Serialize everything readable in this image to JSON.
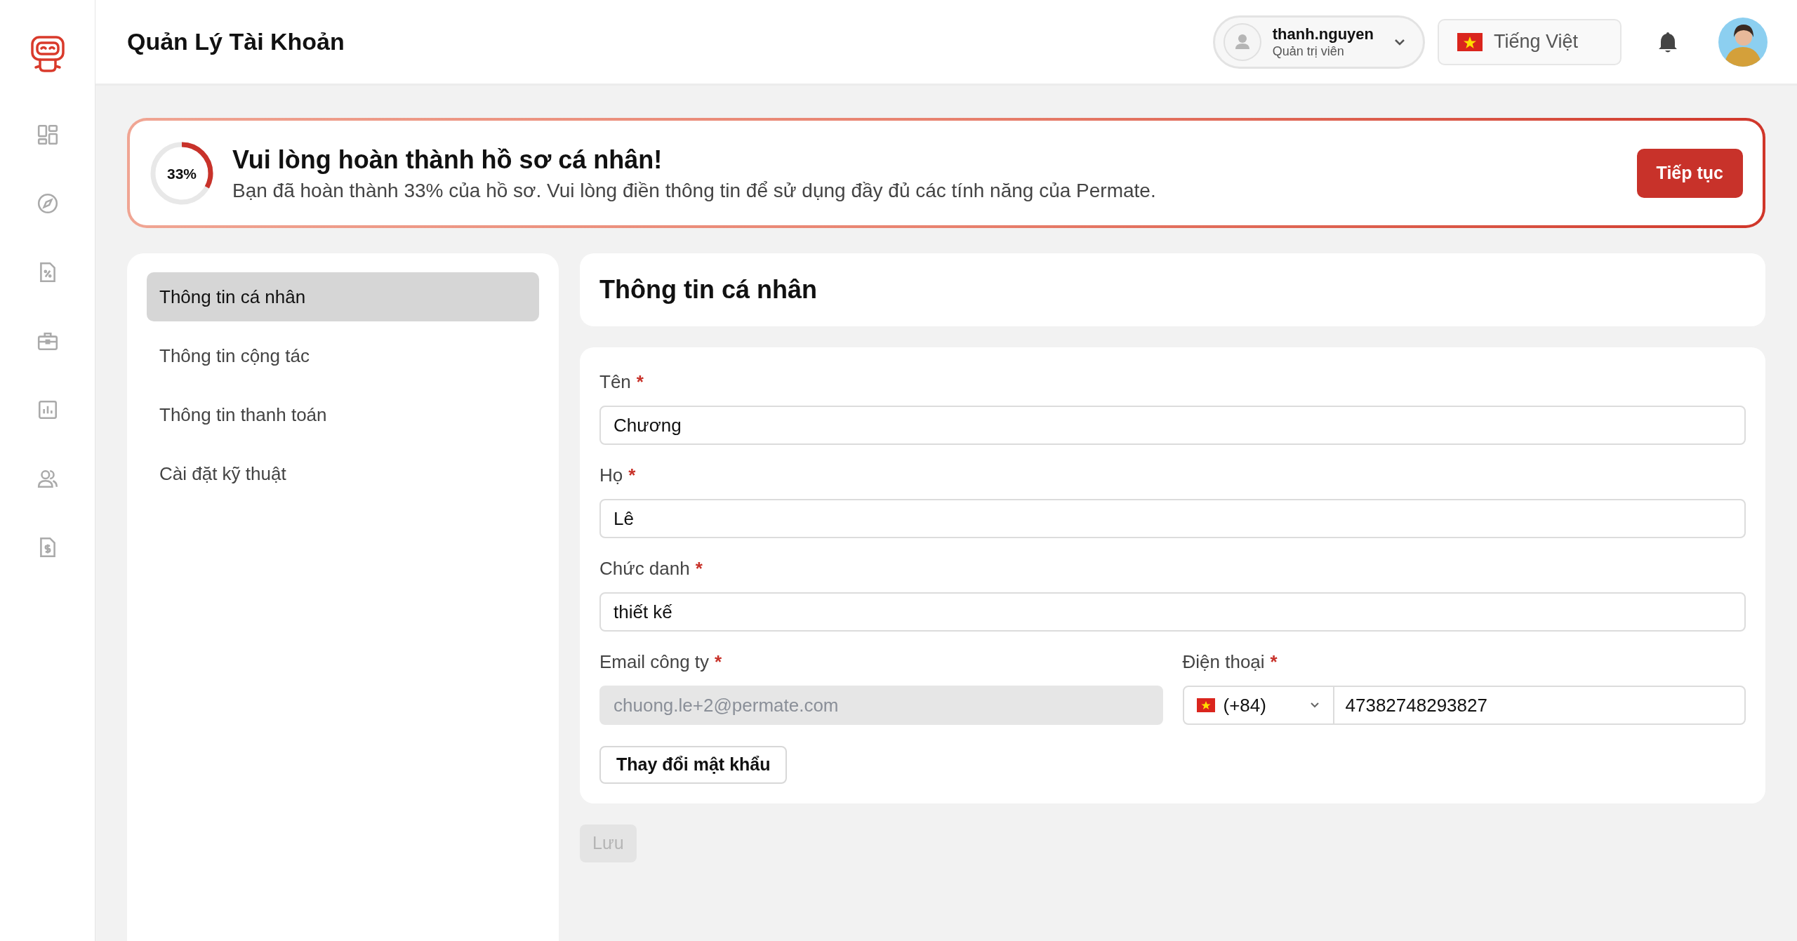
{
  "header": {
    "title": "Quản Lý Tài Khoản",
    "user": {
      "name": "thanh.nguyen",
      "role": "Quản trị viên"
    },
    "language": "Tiếng Việt"
  },
  "banner": {
    "progress": {
      "level": 0.33,
      "label": "33%"
    },
    "title": "Vui lòng hoàn thành hồ sơ cá nhân!",
    "message": "Bạn đã hoàn thành 33% của hồ sơ. Vui lòng điền thông tin để sử dụng đầy đủ các tính năng của Permate.",
    "button": "Tiếp tục"
  },
  "menu": [
    {
      "label": "Thông tin cá nhân",
      "selected": true
    },
    {
      "label": "Thông tin cộng tác",
      "selected": false
    },
    {
      "label": "Thông tin thanh toán",
      "selected": false
    },
    {
      "label": "Cài đặt kỹ thuật",
      "selected": false
    }
  ],
  "section_title": "Thông tin cá nhân",
  "form_rows": [
    [
      {
        "kind": "text",
        "label": "Tên",
        "required_mark": "*",
        "value": "Chương",
        "disabled": false
      }
    ],
    [
      {
        "kind": "text",
        "label": "Họ",
        "required_mark": "*",
        "value": "Lê",
        "disabled": false
      }
    ],
    [
      {
        "kind": "text",
        "label": "Chức danh",
        "required_mark": "*",
        "value": "thiết kế",
        "disabled": false
      }
    ],
    [
      {
        "kind": "text",
        "label": "Email công ty",
        "required_mark": "*",
        "value": "chuong.le+2@permate.com",
        "disabled": true
      },
      {
        "kind": "phone",
        "label": "Điện thoại",
        "required_mark": "*",
        "code": "(+84)",
        "value": "47382748293827",
        "disabled": false
      }
    ]
  ],
  "change_password": "Thay đổi mật khẩu",
  "save": {
    "label": "Lưu",
    "disabled": true
  }
}
